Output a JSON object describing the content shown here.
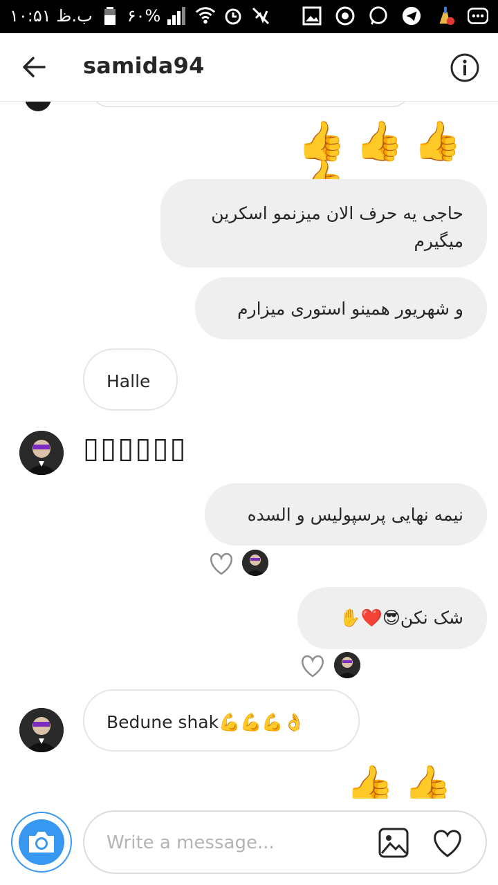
{
  "status_bar": {
    "time": "۱۰:۵۱ ب.ظ",
    "battery": "۶۰%"
  },
  "header": {
    "username": "samida94",
    "back_icon": "arrow-left-icon",
    "info_icon": "info-circle-icon"
  },
  "messages": [
    {
      "side": "right",
      "text": "👍👍👍👍"
    },
    {
      "side": "right",
      "text": "حاجی یه حرف الان میزنمو اسکرین میگیرم"
    },
    {
      "side": "right",
      "text": "و شهریور همینو استوری میزارم"
    },
    {
      "side": "left",
      "text": "Halle"
    },
    {
      "side": "left",
      "text": "▯▯▯▯▯▯"
    },
    {
      "side": "right",
      "text": "نیمه نهایی پرسپولیس و السده"
    },
    {
      "side": "right",
      "text": "شک نکن😎❤️✋"
    },
    {
      "side": "left",
      "text": "Bedune shak💪💪💪👌"
    },
    {
      "side": "right",
      "text": "👍👍👍"
    }
  ],
  "composer": {
    "placeholder": "Write a message...",
    "camera_icon": "camera-icon",
    "gallery_icon": "gallery-icon",
    "like_icon": "heart-icon"
  },
  "colors": {
    "accent": "#3897f0",
    "bubble": "#efefef",
    "text": "#262626"
  }
}
